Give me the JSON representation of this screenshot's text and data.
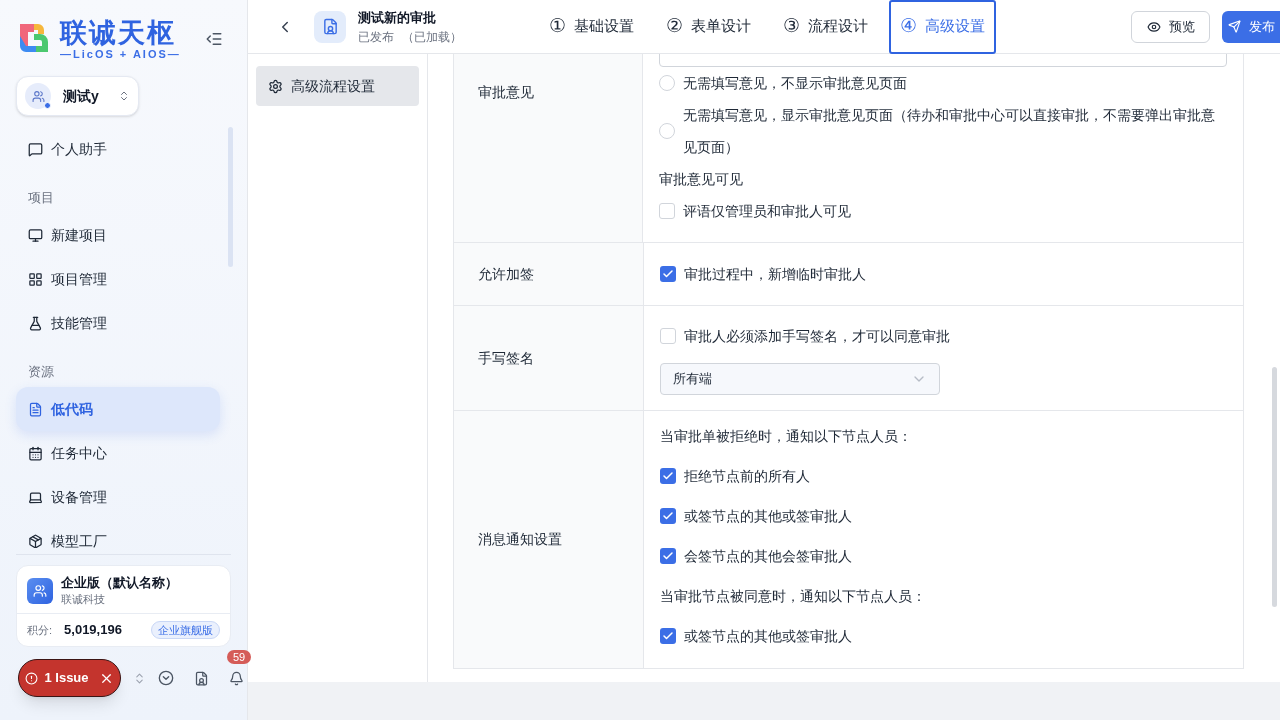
{
  "sidebar": {
    "logo": {
      "name": "联诚天枢",
      "tagline": "—LicOS + AIOS—"
    },
    "workspace": {
      "name": "测试y"
    },
    "nav": [
      {
        "kind": "item",
        "label": "个人助手",
        "selected": false
      },
      {
        "kind": "section",
        "label": "项目"
      },
      {
        "kind": "item",
        "label": "新建项目",
        "selected": false
      },
      {
        "kind": "item",
        "label": "项目管理",
        "selected": false
      },
      {
        "kind": "item",
        "label": "技能管理",
        "selected": false
      },
      {
        "kind": "section",
        "label": "资源"
      },
      {
        "kind": "item",
        "label": "低代码",
        "selected": true
      },
      {
        "kind": "item",
        "label": "任务中心",
        "selected": false
      },
      {
        "kind": "item",
        "label": "设备管理",
        "selected": false
      },
      {
        "kind": "item",
        "label": "模型工厂",
        "selected": false
      }
    ],
    "org": {
      "name": "企业版（默认名称）",
      "company": "联诚科技",
      "points_label": "积分:",
      "points": "5,019,196",
      "plan": "企业旗舰版"
    },
    "issue": {
      "label": "1 Issue"
    },
    "notifications": "59"
  },
  "header": {
    "title": "测试新的审批",
    "status": "已发布",
    "loaded": "（已加载）",
    "steps": [
      {
        "number": "①",
        "label": "基础设置",
        "selected": false
      },
      {
        "number": "②",
        "label": "表单设计",
        "selected": false
      },
      {
        "number": "③",
        "label": "流程设计",
        "selected": false
      },
      {
        "number": "④",
        "label": "高级设置",
        "selected": true
      }
    ],
    "buttons": [
      {
        "kind": "preview",
        "label": "预览"
      },
      {
        "kind": "publish",
        "label": "发布"
      }
    ]
  },
  "subnav": [
    {
      "label": "高级流程设置",
      "selected": true
    }
  ],
  "settings": [
    {
      "label": "审批意见",
      "items": [
        {
          "kind": "field"
        },
        {
          "kind": "radio",
          "text": "无需填写意见，不显示审批意见页面",
          "selected": false
        },
        {
          "kind": "radio",
          "text": "无需填写意见，显示审批意见页面（待办和审批中心可以直接审批，不需要弹出审批意见页面）",
          "selected": false
        },
        {
          "kind": "heading",
          "text": "审批意见可见"
        },
        {
          "kind": "checkbox",
          "text": "评语仅管理员和审批人可见",
          "checked": false
        }
      ]
    },
    {
      "label": "允许加签",
      "items": [
        {
          "kind": "checkbox",
          "text": "审批过程中，新增临时审批人",
          "checked": true
        }
      ]
    },
    {
      "label": "手写签名",
      "items": [
        {
          "kind": "checkbox",
          "text": "审批人必须添加手写签名，才可以同意审批",
          "checked": false
        },
        {
          "kind": "select",
          "value": "所有端"
        }
      ]
    },
    {
      "label": "消息通知设置",
      "items": [
        {
          "kind": "heading",
          "text": "当审批单被拒绝时，通知以下节点人员："
        },
        {
          "kind": "checkbox",
          "text": "拒绝节点前的所有人",
          "checked": true
        },
        {
          "kind": "checkbox",
          "text": "或签节点的其他或签审批人",
          "checked": true
        },
        {
          "kind": "checkbox",
          "text": "会签节点的其他会签审批人",
          "checked": true
        },
        {
          "kind": "heading",
          "text": "当审批节点被同意时，通知以下节点人员："
        },
        {
          "kind": "checkbox",
          "text": "或签节点的其他或签审批人",
          "checked": true
        }
      ]
    }
  ]
}
